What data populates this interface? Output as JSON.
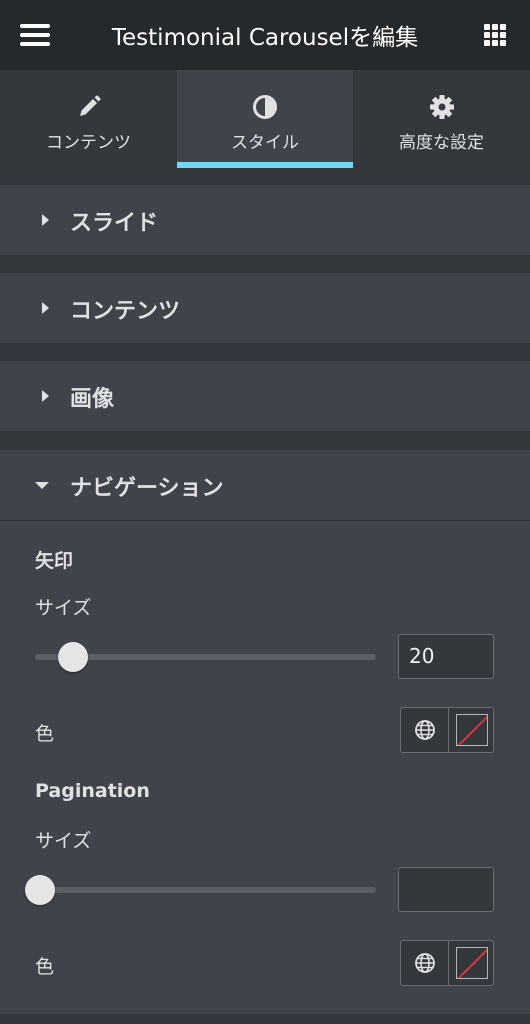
{
  "header": {
    "title": "Testimonial Carouselを編集",
    "menu_icon": "hamburger-icon",
    "apps_icon": "grid-icon"
  },
  "tabs": [
    {
      "label": "コンテンツ",
      "icon": "pencil-icon",
      "active": false
    },
    {
      "label": "スタイル",
      "icon": "half-circle-icon",
      "active": true
    },
    {
      "label": "高度な設定",
      "icon": "gear-icon",
      "active": false
    }
  ],
  "sections": [
    {
      "label": "スライド",
      "expanded": false
    },
    {
      "label": "コンテンツ",
      "expanded": false
    },
    {
      "label": "画像",
      "expanded": false
    },
    {
      "label": "ナビゲーション",
      "expanded": true
    }
  ],
  "navigation": {
    "arrows": {
      "heading": "矢印",
      "size_label": "サイズ",
      "size_value": "20",
      "slider_fraction": 0.11,
      "color_label": "色"
    },
    "pagination": {
      "heading": "Pagination",
      "size_label": "サイズ",
      "size_value": "",
      "slider_fraction": 0.0,
      "color_label": "色"
    }
  },
  "colors": {
    "accent": "#71d7f7",
    "panel": "#404349",
    "background": "#34373c",
    "header": "#26292c",
    "swatch_line": "#d63a3a"
  }
}
